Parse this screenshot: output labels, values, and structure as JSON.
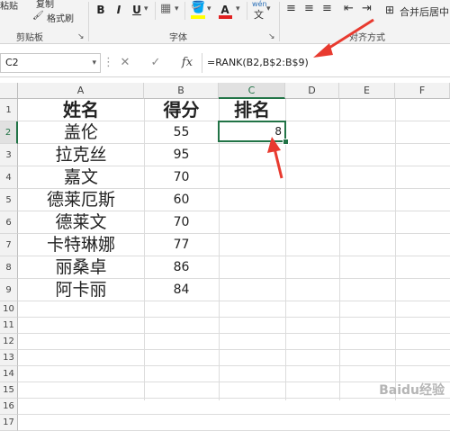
{
  "ribbon": {
    "paste_label": "粘贴",
    "copy_label": "复制",
    "format_painter_label": "格式刷",
    "clipboard_group": "剪贴板",
    "font_group": "字体",
    "align_group": "对齐方式",
    "merge_label": "合并后居中",
    "bold": "B",
    "italic": "I",
    "underline": "U",
    "underline_arrow": "▾",
    "font_color_letter": "A",
    "wen": "文"
  },
  "formula_bar": {
    "name_box": "C2",
    "cancel": "✕",
    "enter": "✓",
    "fx": "fx",
    "formula": "=RANK(B2,B$2:B$9)"
  },
  "columns": [
    "A",
    "B",
    "C",
    "D",
    "E",
    "F"
  ],
  "rows": [
    "1",
    "2",
    "3",
    "4",
    "5",
    "6",
    "7",
    "8",
    "9",
    "10",
    "11",
    "12",
    "13",
    "14",
    "15",
    "16",
    "17"
  ],
  "table": {
    "header_name": "姓名",
    "header_score": "得分",
    "header_rank": "排名",
    "names": [
      "盖伦",
      "拉克丝",
      "嘉文",
      "德莱厄斯",
      "德莱文",
      "卡特琳娜",
      "丽桑卓",
      "阿卡丽"
    ],
    "scores": [
      "55",
      "95",
      "70",
      "60",
      "70",
      "77",
      "86",
      "84"
    ],
    "active_value": "8"
  },
  "colors": {
    "accent": "#217346",
    "arrow": "#e83a2f"
  },
  "watermark": "Baidu经验"
}
